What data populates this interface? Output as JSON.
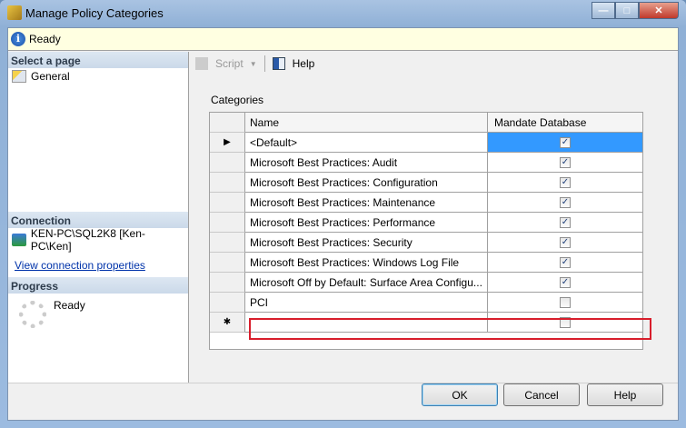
{
  "window": {
    "title": "Manage Policy Categories"
  },
  "status": {
    "text": "Ready"
  },
  "sidebar": {
    "select_page": "Select a page",
    "pages": [
      {
        "label": "General"
      }
    ],
    "connection_header": "Connection",
    "connection": "KEN-PC\\SQL2K8 [Ken-PC\\Ken]",
    "view_link": "View connection properties",
    "progress_header": "Progress",
    "progress_status": "Ready"
  },
  "toolbar": {
    "script": "Script",
    "help": "Help"
  },
  "categories": {
    "label": "Categories",
    "columns": [
      "Name",
      "Mandate Database"
    ],
    "rows": [
      {
        "name": "<Default>",
        "mandate": true
      },
      {
        "name": "Microsoft Best Practices: Audit",
        "mandate": true
      },
      {
        "name": "Microsoft Best Practices: Configuration",
        "mandate": true
      },
      {
        "name": "Microsoft Best Practices: Maintenance",
        "mandate": true
      },
      {
        "name": "Microsoft Best Practices: Performance",
        "mandate": true
      },
      {
        "name": "Microsoft Best Practices: Security",
        "mandate": true
      },
      {
        "name": "Microsoft Best Practices: Windows Log File",
        "mandate": true
      },
      {
        "name": "Microsoft Off by Default: Surface Area Configu...",
        "mandate": true
      },
      {
        "name": "PCI",
        "mandate": false
      },
      {
        "name": "",
        "mandate": false
      }
    ]
  },
  "buttons": {
    "ok": "OK",
    "cancel": "Cancel",
    "help": "Help"
  }
}
